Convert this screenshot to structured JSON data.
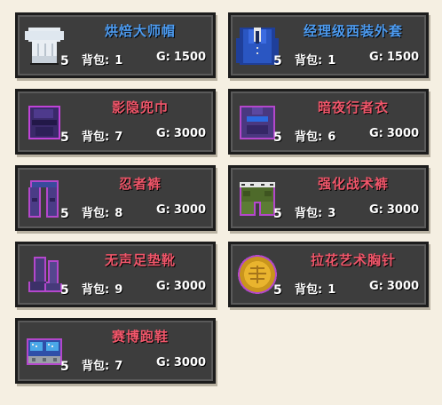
{
  "colors": {
    "rare": "#4d9bf0",
    "epic": "#f0566a",
    "background": "#f5efe2"
  },
  "labels": {
    "bag": "背包:",
    "gold": "G:"
  },
  "items": [
    {
      "name": "烘焙大师帽",
      "rarity": "rare",
      "quantity": "5",
      "bag": "1",
      "gold": "1500",
      "icon": "chef-hat-icon"
    },
    {
      "name": "经理级西装外套",
      "rarity": "rare",
      "quantity": "5",
      "bag": "1",
      "gold": "1500",
      "icon": "suit-jacket-icon"
    },
    {
      "name": "影隐兜巾",
      "rarity": "epic",
      "quantity": "5",
      "bag": "7",
      "gold": "3000",
      "icon": "ninja-hood-icon"
    },
    {
      "name": "暗夜行者衣",
      "rarity": "epic",
      "quantity": "5",
      "bag": "6",
      "gold": "3000",
      "icon": "ninja-garb-icon"
    },
    {
      "name": "忍者裤",
      "rarity": "epic",
      "quantity": "5",
      "bag": "8",
      "gold": "3000",
      "icon": "ninja-pants-icon"
    },
    {
      "name": "强化战术裤",
      "rarity": "epic",
      "quantity": "5",
      "bag": "3",
      "gold": "3000",
      "icon": "tactical-pants-icon"
    },
    {
      "name": "无声足垫靴",
      "rarity": "epic",
      "quantity": "5",
      "bag": "9",
      "gold": "3000",
      "icon": "silent-boots-icon"
    },
    {
      "name": "拉花艺术胸针",
      "rarity": "epic",
      "quantity": "5",
      "bag": "1",
      "gold": "3000",
      "icon": "latte-art-brooch-icon"
    },
    {
      "name": "赛博跑鞋",
      "rarity": "epic",
      "quantity": "5",
      "bag": "7",
      "gold": "3000",
      "icon": "cyber-sneakers-icon"
    }
  ]
}
